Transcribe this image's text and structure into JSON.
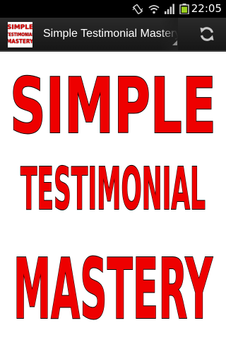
{
  "status_bar": {
    "time": "22:05",
    "icons": [
      "vibrate-icon",
      "wifi-icon",
      "signal-icon",
      "battery-icon"
    ]
  },
  "action_bar": {
    "title": "Simple Testimonial Mastery",
    "app_icon_lines": [
      "SIMPLE",
      "TESTIMONIAL",
      "MASTERY"
    ],
    "refresh_icon": "refresh-icon"
  },
  "content": {
    "logo_lines": [
      "SIMPLE",
      "TESTIMONIAL",
      "MASTERY"
    ],
    "logo_color": "#ee0000",
    "outline_color": "#000000"
  }
}
